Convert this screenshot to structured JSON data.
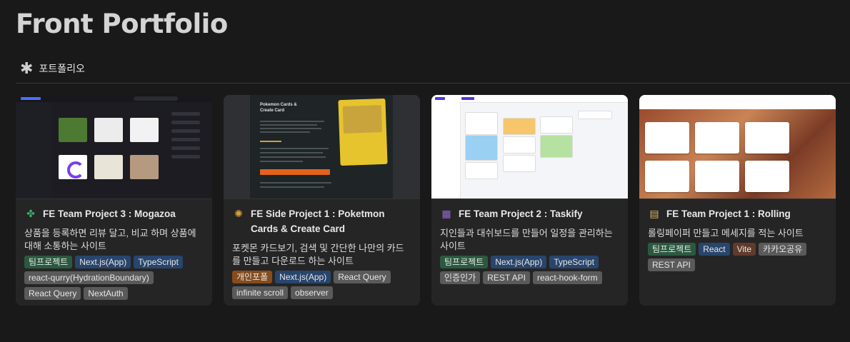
{
  "page": {
    "title": "Front Portfolio",
    "view_tab": {
      "icon": "asterisk-icon",
      "label": "포트폴리오"
    }
  },
  "cards": [
    {
      "icon": "clover-icon",
      "title": "FE Team Project 3 : Mogazoa",
      "description": "상품을 등록하면 리뷰 달고, 비교 하며 상품에 대해 소통하는 사이트",
      "tags": [
        {
          "label": "팀프로젝트",
          "color": "green"
        },
        {
          "label": "Next.js(App)",
          "color": "blue"
        },
        {
          "label": "TypeScript",
          "color": "blue"
        },
        {
          "label": "react-qurry(HydrationBoundary)",
          "color": "gray"
        },
        {
          "label": "React Query",
          "color": "gray"
        },
        {
          "label": "NextAuth",
          "color": "gray"
        }
      ]
    },
    {
      "icon": "pokeball-icon",
      "title": "FE Side Project 1 : Poketmon Cards & Create Card",
      "description": "포켓몬 카드보기, 검색 및 간단한 나만의 카드를 만들고 다운로드 하는 사이트",
      "tags": [
        {
          "label": "개인포폴",
          "color": "orange"
        },
        {
          "label": "Next.js(App)",
          "color": "blue"
        },
        {
          "label": "React Query",
          "color": "gray"
        },
        {
          "label": "infinite scroll",
          "color": "gray"
        },
        {
          "label": "observer",
          "color": "gray"
        }
      ]
    },
    {
      "icon": "calendar-icon",
      "title": "FE Team Project 2 : Taskify",
      "description": "지인들과 대쉬보드를 만들어 일정을 관리하는 사이트",
      "tags": [
        {
          "label": "팀프로젝트",
          "color": "green"
        },
        {
          "label": "Next.js(App)",
          "color": "blue"
        },
        {
          "label": "TypeScript",
          "color": "blue"
        },
        {
          "label": "인증인가",
          "color": "gray"
        },
        {
          "label": "REST API",
          "color": "gray"
        },
        {
          "label": "react-hook-form",
          "color": "gray"
        }
      ]
    },
    {
      "icon": "scroll-icon",
      "title": "FE Team Project 1 : Rolling",
      "description": "롤링페이퍼 만들고 메세지를 적는 사이트",
      "tags": [
        {
          "label": "팀프로젝트",
          "color": "green"
        },
        {
          "label": "React",
          "color": "blue"
        },
        {
          "label": "Vite",
          "color": "brown"
        },
        {
          "label": "카카오공유",
          "color": "gray"
        },
        {
          "label": "REST API",
          "color": "gray"
        }
      ]
    }
  ],
  "colors": {
    "background": "#191919",
    "card": "#252525",
    "tag_green": "#2b593f",
    "tag_blue": "#28456c",
    "tag_gray": "#5a5a5a",
    "tag_orange": "#854c1d",
    "tag_brown": "#603b2c"
  }
}
